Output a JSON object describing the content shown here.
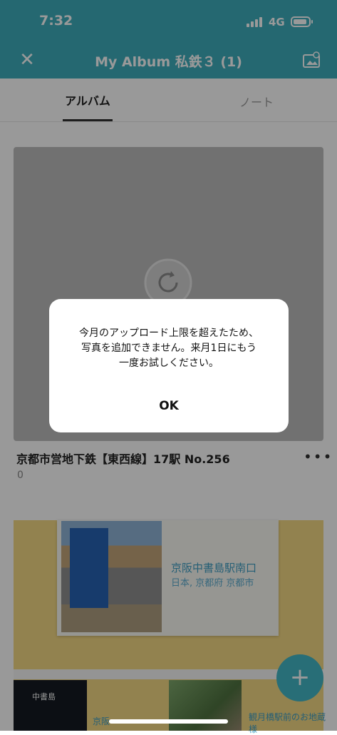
{
  "status_bar": {
    "time": "7:32",
    "network": "4G"
  },
  "nav": {
    "close_glyph": "✕",
    "title": "My Album 私鉄３ (1)",
    "action_icon": "photo-add-icon"
  },
  "tabs": [
    {
      "label": "アルバム",
      "selected": true
    },
    {
      "label": "ノート",
      "selected": false
    }
  ],
  "album_card": {
    "title": "京都市営地下鉄【東西線】17駅 No.256",
    "count": "0",
    "more_glyph": "•••"
  },
  "collage": {
    "photo_label": "京阪中書島駅南口",
    "photo_sublabel": "日本, 京都府 京都市",
    "thumb_caption": "中書島",
    "item2_text": "京阪",
    "item3_text": "観月橋駅前のお地蔵様"
  },
  "fab": {
    "glyph": "+"
  },
  "alert": {
    "message": "今月のアップロード上限を超えたため、写真を追加できません。来月1日にもう一度お試しください。",
    "ok_label": "OK"
  },
  "colors": {
    "accent": "#3eaebd",
    "fab": "#44b7c7"
  }
}
